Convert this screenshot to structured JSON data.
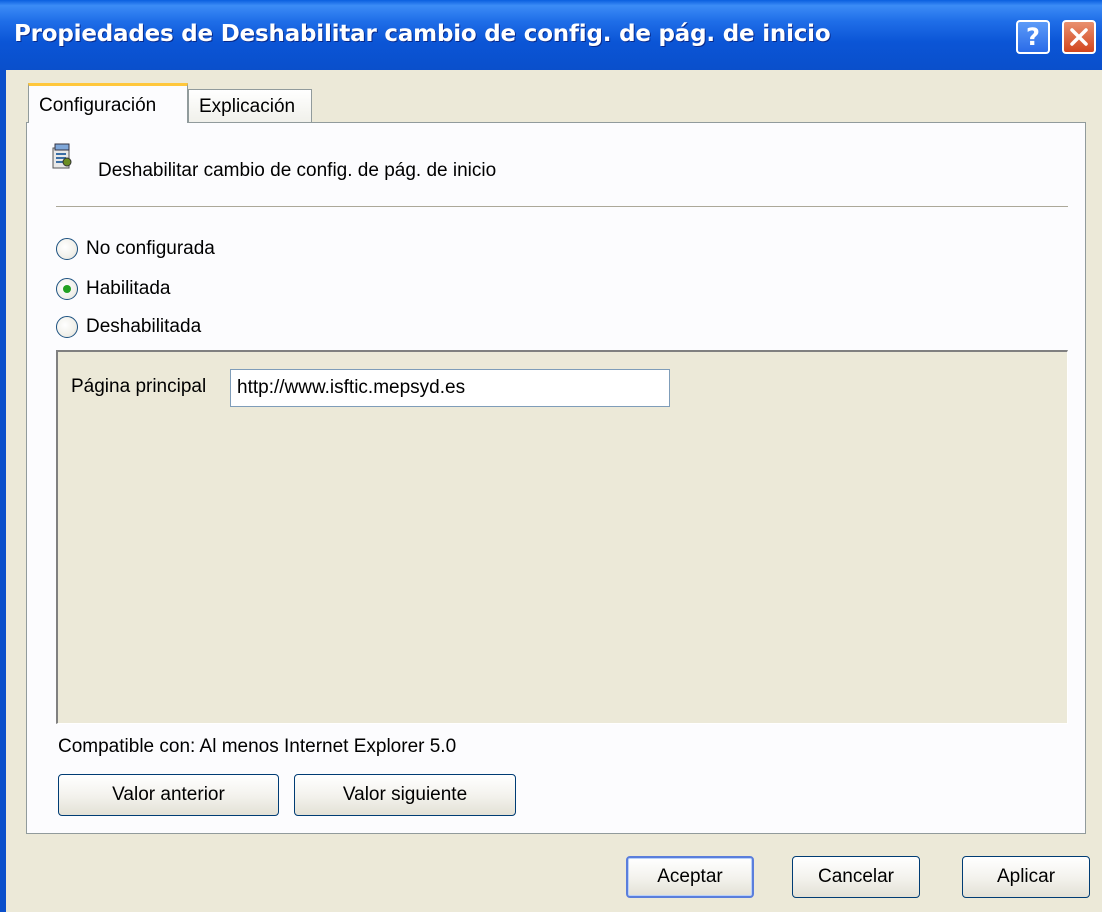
{
  "window": {
    "title": "Propiedades de Deshabilitar cambio de config. de pág. de inicio",
    "help_glyph": "?"
  },
  "tabs": [
    {
      "label": "Configuración",
      "active": true
    },
    {
      "label": "Explicación",
      "active": false
    }
  ],
  "policy": {
    "name": "Deshabilitar cambio de config. de pág. de inicio",
    "icon": "policy-setting-icon"
  },
  "state_options": [
    {
      "label": "No configurada",
      "checked": false
    },
    {
      "label": "Habilitada",
      "checked": true
    },
    {
      "label": "Deshabilitada",
      "checked": false
    }
  ],
  "options": {
    "home_page_label": "Página principal",
    "home_page_value": "http://www.isftic.mepsyd.es"
  },
  "supported_on": "Compatible con: Al menos Internet Explorer 5.0",
  "nav_buttons": {
    "previous": "Valor anterior",
    "next": "Valor siguiente"
  },
  "dialog_buttons": {
    "ok": "Aceptar",
    "cancel": "Cancelar",
    "apply": "Aplicar"
  },
  "colors": {
    "titlebar": "#0A4FCB",
    "close_button": "#D2461E",
    "tab_highlight": "#FFC73C",
    "radio_dot": "#21A121"
  }
}
